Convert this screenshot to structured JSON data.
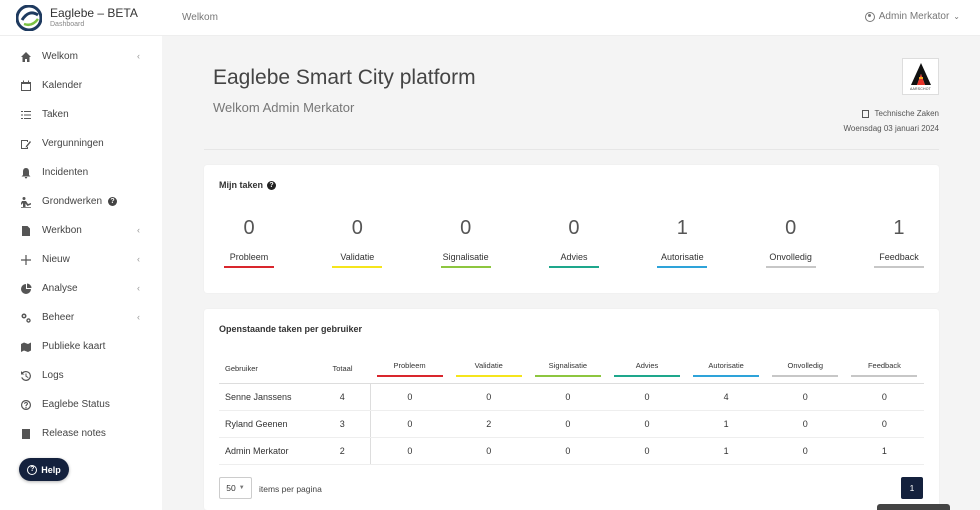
{
  "app": {
    "title": "Eaglebe – BETA",
    "subtitle": "Dashboard"
  },
  "topbar": {
    "title": "Welkom",
    "user": "Admin Merkator"
  },
  "sidebar": {
    "items": [
      {
        "label": "Welkom",
        "icon": "home-icon",
        "chevron": true
      },
      {
        "label": "Kalender",
        "icon": "calendar-icon",
        "chevron": false
      },
      {
        "label": "Taken",
        "icon": "task-list-icon",
        "chevron": false
      },
      {
        "label": "Vergunningen",
        "icon": "permit-icon",
        "chevron": false
      },
      {
        "label": "Incidenten",
        "icon": "bell-icon",
        "chevron": false
      },
      {
        "label": "Grondwerken",
        "icon": "digging-icon",
        "chevron": false,
        "help": true
      },
      {
        "label": "Werkbon",
        "icon": "document-icon",
        "chevron": true
      },
      {
        "label": "Nieuw",
        "icon": "plus-icon",
        "chevron": true
      },
      {
        "label": "Analyse",
        "icon": "chart-icon",
        "chevron": true
      },
      {
        "label": "Beheer",
        "icon": "gears-icon",
        "chevron": true
      },
      {
        "label": "Publieke kaart",
        "icon": "map-icon",
        "chevron": false
      },
      {
        "label": "Logs",
        "icon": "history-icon",
        "chevron": false
      },
      {
        "label": "Eaglebe Status",
        "icon": "help-circle-icon",
        "chevron": false
      },
      {
        "label": "Release notes",
        "icon": "notes-icon",
        "chevron": false
      }
    ],
    "help_label": "Help"
  },
  "header": {
    "title": "Eaglebe Smart City platform",
    "subtitle": "Welkom Admin Merkator",
    "city_logo_text": "AARSCHOT",
    "department": "Technische Zaken",
    "date": "Woensdag 03 januari 2024"
  },
  "tasks": {
    "title": "Mijn taken",
    "stats": [
      {
        "label": "Probleem",
        "value": "0",
        "color": "#d9262d"
      },
      {
        "label": "Validatie",
        "value": "0",
        "color": "#f5e51c"
      },
      {
        "label": "Signalisatie",
        "value": "0",
        "color": "#8dc63f"
      },
      {
        "label": "Advies",
        "value": "0",
        "color": "#1ea78c"
      },
      {
        "label": "Autorisatie",
        "value": "1",
        "color": "#2ea3d9"
      },
      {
        "label": "Onvolledig",
        "value": "0",
        "color": "#c7c7c7"
      },
      {
        "label": "Feedback",
        "value": "1",
        "color": "#c7c7c7"
      }
    ]
  },
  "users_table": {
    "title": "Openstaande taken per gebruiker",
    "col_user": "Gebruiker",
    "col_total": "Totaal",
    "rows": [
      {
        "user": "Senne Janssens",
        "total": "4",
        "values": [
          "0",
          "0",
          "0",
          "0",
          "4",
          "0",
          "0"
        ]
      },
      {
        "user": "Ryland Geenen",
        "total": "3",
        "values": [
          "0",
          "2",
          "0",
          "0",
          "1",
          "0",
          "0"
        ]
      },
      {
        "user": "Admin Merkator",
        "total": "2",
        "values": [
          "0",
          "0",
          "0",
          "0",
          "1",
          "0",
          "1"
        ]
      }
    ],
    "page_size": "50",
    "page_size_label": "items per pagina",
    "current_page": "1"
  }
}
